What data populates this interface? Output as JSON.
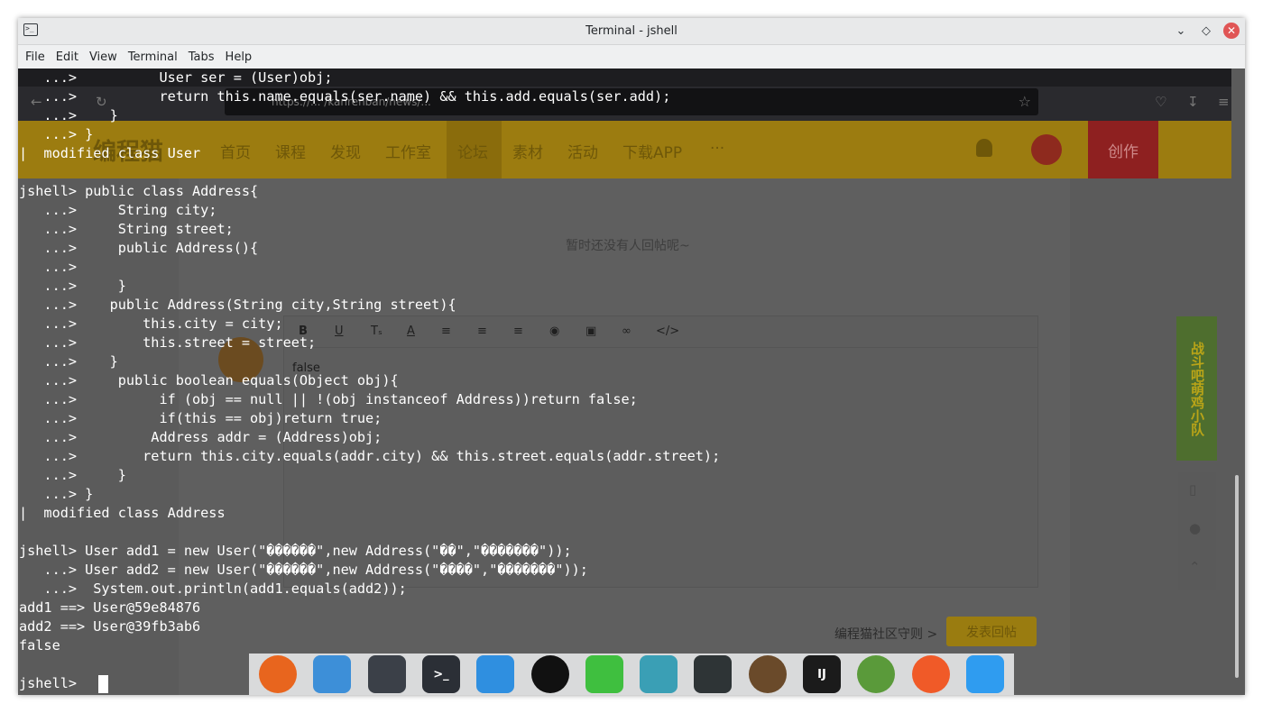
{
  "window": {
    "title": "Terminal - jshell",
    "menu": [
      "File",
      "Edit",
      "View",
      "Terminal",
      "Tabs",
      "Help"
    ],
    "controls": [
      "chevron-down-icon",
      "diamond-icon",
      "close-icon"
    ]
  },
  "background_page": {
    "url": "https://... /kanrenban/news/...",
    "logo": "编程猫",
    "nav": [
      "首页",
      "课程",
      "发现",
      "工作室",
      "论坛",
      "素材",
      "活动",
      "下载APP",
      "···"
    ],
    "create_button": "创作",
    "no_reply_text": "暂时还没有人回帖呢~",
    "editor_text": "false",
    "rules_link": "编程猫社区守则 >",
    "reply_button": "发表回帖",
    "ad_text": "战斗吧萌鸡小队"
  },
  "terminal": {
    "lines": [
      "   ...>          User ser = (User)obj;",
      "   ...>          return this.name.equals(ser.name) && this.add.equals(ser.add);",
      "   ...>    }",
      "   ...> }",
      "|  modified class User",
      "",
      "jshell> public class Address{",
      "   ...>     String city;",
      "   ...>     String street;",
      "   ...>     public Address(){",
      "   ...>",
      "   ...>     }",
      "   ...>    public Address(String city,String street){",
      "   ...>        this.city = city;",
      "   ...>        this.street = street;",
      "   ...>    }",
      "   ...>     public boolean equals(Object obj){",
      "   ...>          if (obj == null || !(obj instanceof Address))return false;",
      "   ...>          if(this == obj)return true;",
      "   ...>         Address addr = (Address)obj;",
      "   ...>        return this.city.equals(addr.city) && this.street.equals(addr.street);",
      "   ...>     }",
      "   ...> }",
      "|  modified class Address",
      "",
      "jshell> User add1 = new User(\"������\",new Address(\"��\",\"�������\"));",
      "   ...> User add2 = new User(\"������\",new Address(\"����\",\"�������\"));",
      "   ...>  System.out.println(add1.equals(add2));",
      "add1 ==> User@59e84876",
      "add2 ==> User@39fb3ab6",
      "false",
      "",
      "jshell> "
    ]
  },
  "dock": [
    {
      "name": "firefox-icon",
      "label": "",
      "color": "#e8651e"
    },
    {
      "name": "file-manager-icon",
      "label": "",
      "color": "#3d8fd8"
    },
    {
      "name": "settings-icon",
      "label": "",
      "color": "#3b4048"
    },
    {
      "name": "terminal-icon",
      "label": ">_",
      "color": "#2b2f36"
    },
    {
      "name": "bird-app-icon",
      "label": "",
      "color": "#2f8fe0"
    },
    {
      "name": "qq-penguin-icon",
      "label": "",
      "color": "#111111"
    },
    {
      "name": "wechat-icon",
      "label": "",
      "color": "#3fbf3f"
    },
    {
      "name": "screenshot-icon",
      "label": "",
      "color": "#3a9fb5"
    },
    {
      "name": "cassette-icon",
      "label": "",
      "color": "#2e3436"
    },
    {
      "name": "beaver-icon",
      "label": "",
      "color": "#6a4a2a"
    },
    {
      "name": "intellij-icon",
      "label": "IJ",
      "color": "#1b1b1b"
    },
    {
      "name": "android-studio-icon",
      "label": "",
      "color": "#5a9a3a"
    },
    {
      "name": "rocket-icon",
      "label": "",
      "color": "#f05a28"
    },
    {
      "name": "document-icon",
      "label": "",
      "color": "#2f9cf0"
    }
  ]
}
